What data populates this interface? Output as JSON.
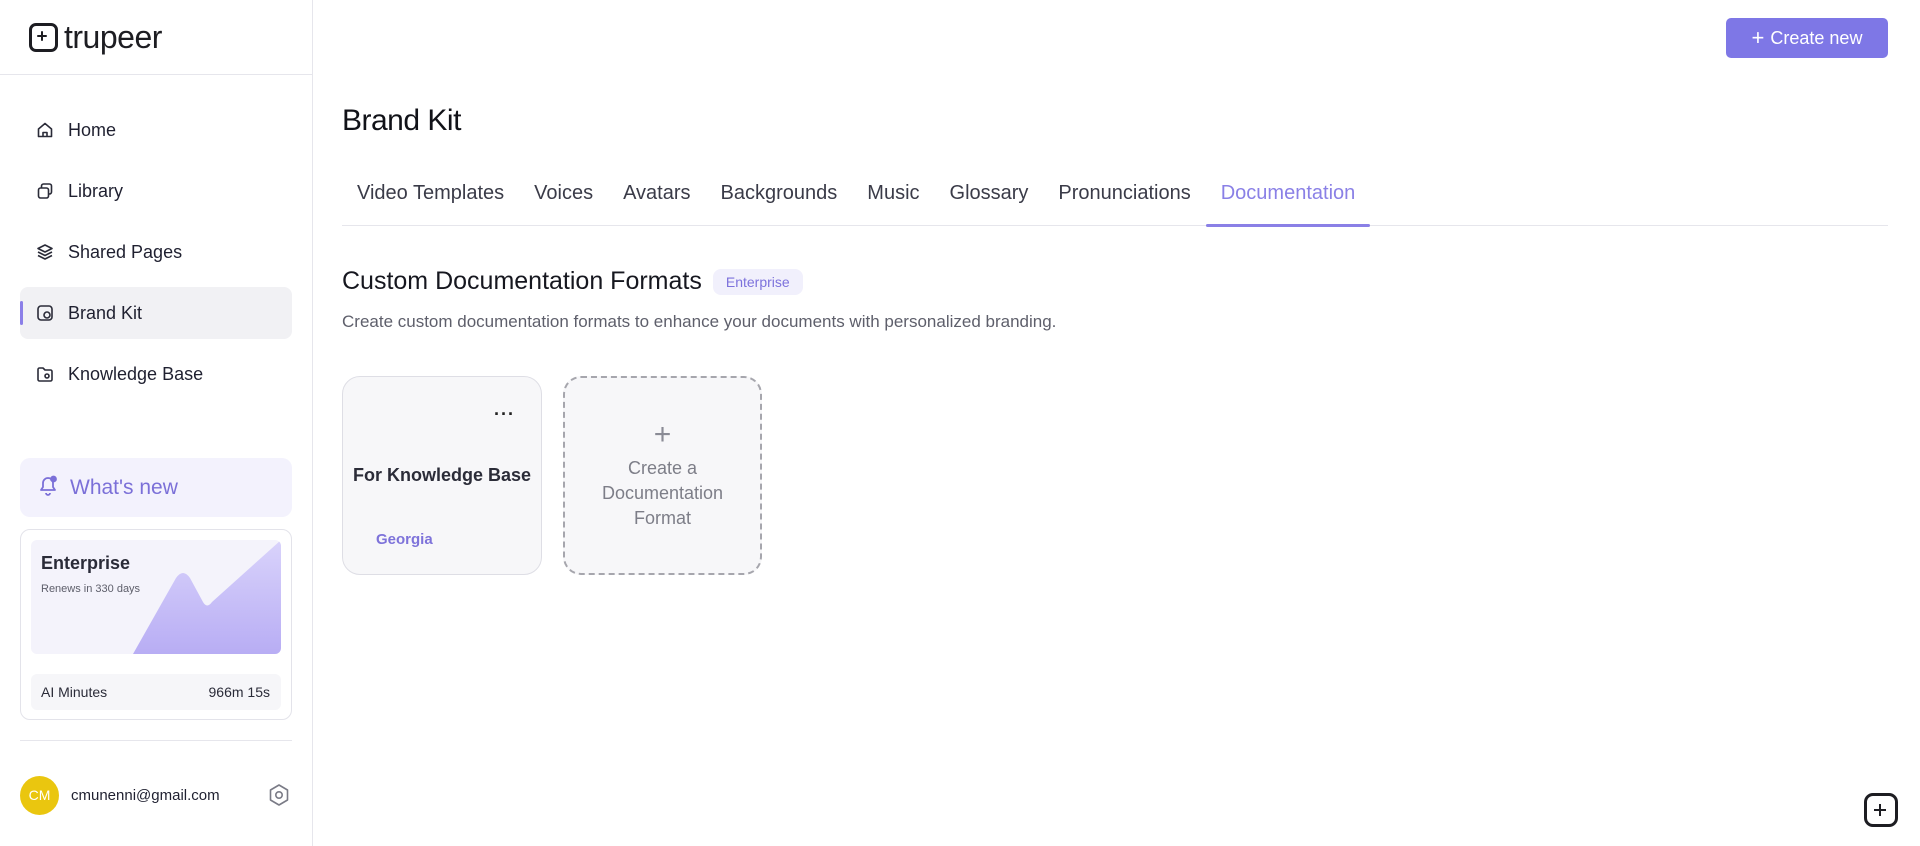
{
  "app": {
    "logo_text": "trupeer"
  },
  "sidebar": {
    "items": [
      {
        "label": "Home",
        "icon": "home-icon",
        "active": false
      },
      {
        "label": "Library",
        "icon": "library-icon",
        "active": false
      },
      {
        "label": "Shared Pages",
        "icon": "layers-icon",
        "active": false
      },
      {
        "label": "Brand Kit",
        "icon": "brand-kit-icon",
        "active": true
      },
      {
        "label": "Knowledge Base",
        "icon": "folder-icon",
        "active": false
      }
    ],
    "whats_new": {
      "label": "What's new",
      "icon": "bell-icon"
    },
    "plan": {
      "name": "Enterprise",
      "renews": "Renews in 330 days",
      "metric_label": "AI Minutes",
      "metric_value": "966m 15s"
    },
    "user": {
      "initials": "CM",
      "email": "cmunenni@gmail.com",
      "avatar_color": "#eac60f"
    }
  },
  "header": {
    "create_label": "Create new"
  },
  "page": {
    "title": "Brand Kit",
    "tabs": [
      {
        "label": "Video Templates",
        "active": false
      },
      {
        "label": "Voices",
        "active": false
      },
      {
        "label": "Avatars",
        "active": false
      },
      {
        "label": "Backgrounds",
        "active": false
      },
      {
        "label": "Music",
        "active": false
      },
      {
        "label": "Glossary",
        "active": false
      },
      {
        "label": "Pronunciations",
        "active": false
      },
      {
        "label": "Documentation",
        "active": true
      }
    ],
    "section": {
      "title": "Custom Documentation Formats",
      "badge": "Enterprise",
      "description": "Create custom documentation formats to enhance your documents with personalized branding."
    },
    "formats": [
      {
        "name": "For Knowledge Base",
        "font": "Georgia"
      }
    ],
    "add_card": {
      "plus": "+",
      "label": "Create a Documentation Format"
    }
  },
  "colors": {
    "accent": "#8a80e6",
    "button": "#7e77e6"
  }
}
